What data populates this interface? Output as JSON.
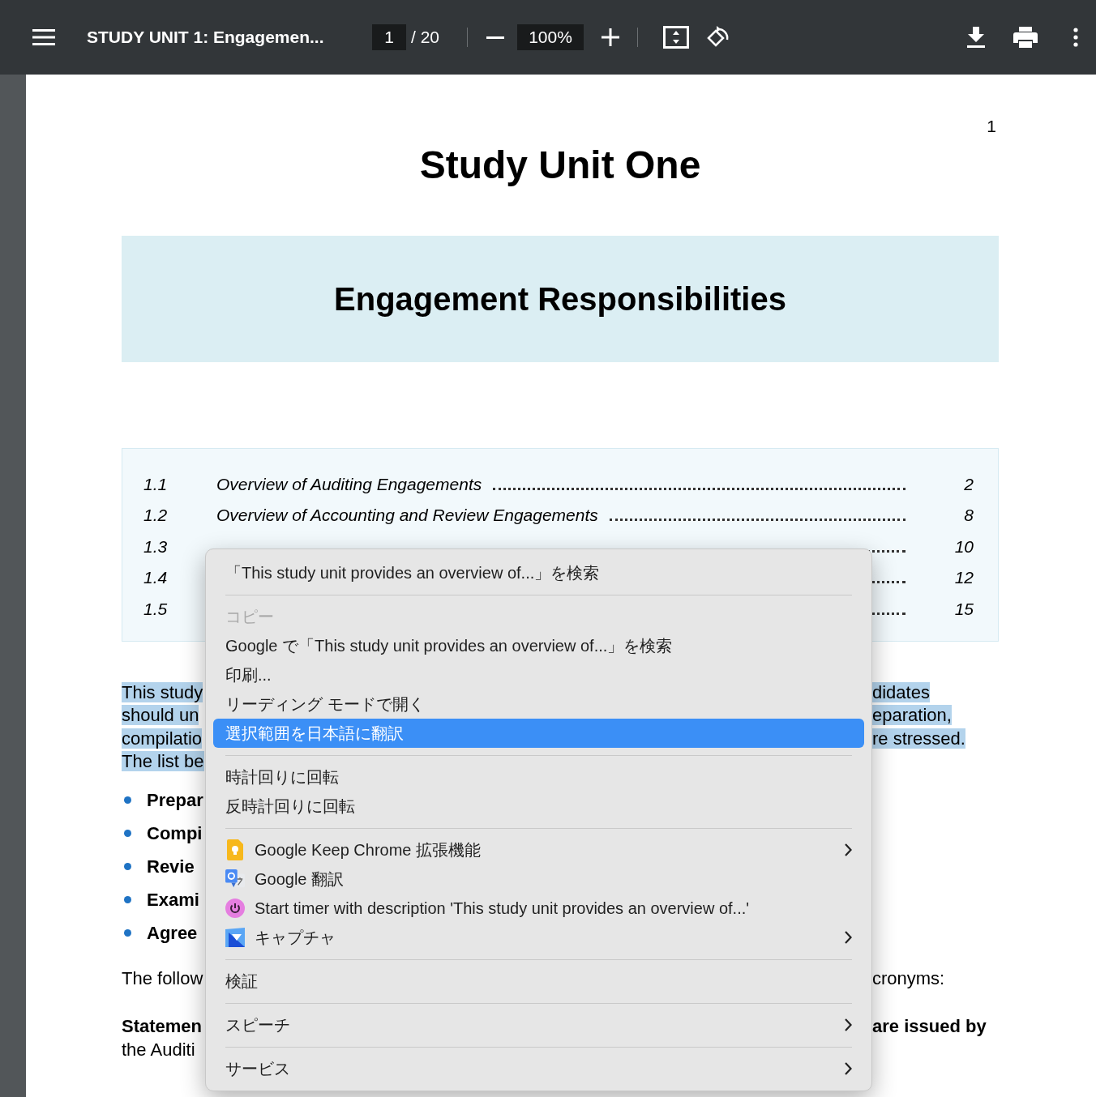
{
  "toolbar": {
    "title": "STUDY UNIT 1: Engagemen...",
    "page_current": "1",
    "page_total": "/ 20",
    "zoom": "100%"
  },
  "document": {
    "page_number": "1",
    "title": "Study Unit One",
    "banner": "Engagement Responsibilities",
    "toc": [
      {
        "number": "1.1",
        "title": "Overview of Auditing Engagements",
        "page": "2"
      },
      {
        "number": "1.2",
        "title": "Overview of Accounting and Review Engagements",
        "page": "8"
      },
      {
        "number": "1.3",
        "page": "10"
      },
      {
        "number": "1.4",
        "page": "12"
      },
      {
        "number": "1.5",
        "page": "15"
      }
    ],
    "intro_lines": [
      {
        "left": "This study",
        "right": "didates",
        "highlighted": true
      },
      {
        "left": "should un",
        "right": "eparation,",
        "highlighted": true
      },
      {
        "left": "compilatio",
        "right": "re stressed.",
        "highlighted": true
      },
      {
        "left": "The list be",
        "highlighted": true
      }
    ],
    "bullets": [
      "Prepar",
      "Compi",
      "Revie",
      "Exami",
      "Agree"
    ],
    "after_lines": [
      {
        "left": "The follow",
        "right": "cronyms:",
        "bold": false
      },
      {
        "left": "Statemen",
        "right": "are issued by",
        "bold": true
      },
      {
        "left": "the Auditi",
        "bold": false
      }
    ]
  },
  "context_menu": [
    {
      "kind": "item",
      "label": "「This study unit provides an overview of...」を検索",
      "disabled": false,
      "selected": false,
      "submenu": false
    },
    {
      "kind": "separator"
    },
    {
      "kind": "item",
      "label": "コピー",
      "disabled": true,
      "selected": false,
      "submenu": false
    },
    {
      "kind": "item",
      "label": "Google で「This study unit provides an overview of...」を検索",
      "disabled": false,
      "selected": false,
      "submenu": false
    },
    {
      "kind": "item",
      "label": "印刷...",
      "disabled": false,
      "selected": false,
      "submenu": false
    },
    {
      "kind": "item",
      "label": "リーディング モードで開く",
      "disabled": false,
      "selected": false,
      "submenu": false
    },
    {
      "kind": "item",
      "label": "選択範囲を日本語に翻訳",
      "disabled": false,
      "selected": true,
      "submenu": false
    },
    {
      "kind": "separator"
    },
    {
      "kind": "item",
      "label": "時計回りに回転",
      "disabled": false,
      "selected": false,
      "submenu": false
    },
    {
      "kind": "item",
      "label": "反時計回りに回転",
      "disabled": false,
      "selected": false,
      "submenu": false
    },
    {
      "kind": "separator"
    },
    {
      "kind": "extension",
      "label": "Google Keep Chrome 拡張機能",
      "disabled": false,
      "selected": false,
      "submenu": true
    },
    {
      "kind": "extension",
      "label": "Google 翻訳",
      "disabled": false,
      "selected": false,
      "submenu": false
    },
    {
      "kind": "extension",
      "label": "Start timer with description 'This study unit provides an overview of...'",
      "disabled": false,
      "selected": false,
      "submenu": false
    },
    {
      "kind": "extension",
      "label": "キャプチャ",
      "disabled": false,
      "selected": false,
      "submenu": true
    },
    {
      "kind": "separator"
    },
    {
      "kind": "item",
      "label": "検証",
      "disabled": false,
      "selected": false,
      "submenu": false
    },
    {
      "kind": "separator"
    },
    {
      "kind": "item",
      "label": "スピーチ",
      "disabled": false,
      "selected": false,
      "submenu": true
    },
    {
      "kind": "separator"
    },
    {
      "kind": "item",
      "label": "サービス",
      "disabled": false,
      "selected": false,
      "submenu": true
    }
  ]
}
